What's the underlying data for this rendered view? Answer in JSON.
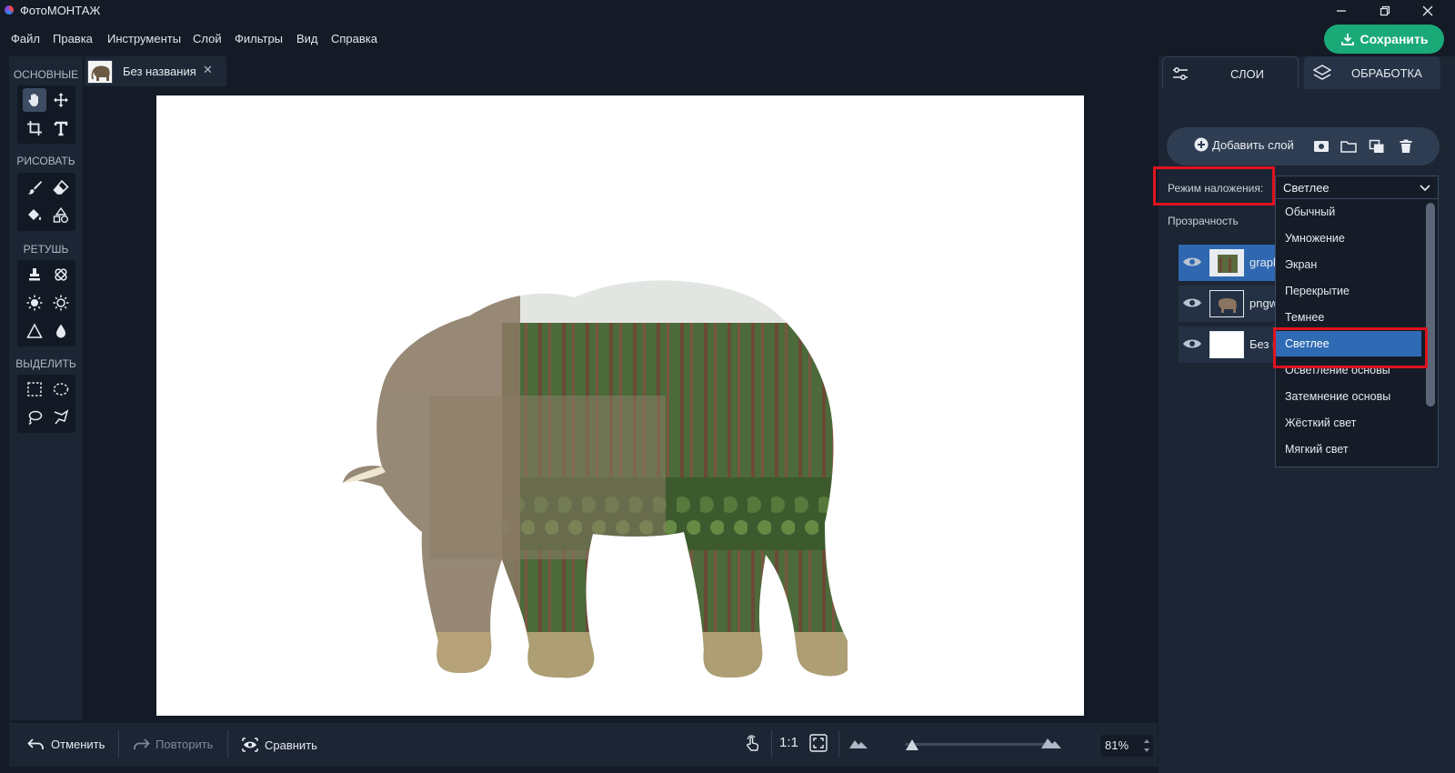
{
  "app": {
    "title": "ФотоМОНТАЖ"
  },
  "menu": [
    "Файл",
    "Правка",
    "Инструменты",
    "Слой",
    "Фильтры",
    "Вид",
    "Справка"
  ],
  "save_label": "Сохранить",
  "tools": {
    "sections": [
      "ОСНОВНЫЕ",
      "РИСОВАТЬ",
      "РЕТУШЬ",
      "ВЫДЕЛИТЬ"
    ]
  },
  "document": {
    "tab_label": "Без названия"
  },
  "right_panel": {
    "tab_layers": "СЛОИ",
    "tab_processing": "ОБРАБОТКА",
    "add_layer": "Добавить слой",
    "blend_label": "Режим наложения:",
    "blend_value": "Светлее",
    "opacity_label": "Прозрачность",
    "layers": [
      {
        "name": "grapl",
        "selected": true
      },
      {
        "name": "pngw",
        "selected": false
      },
      {
        "name": "Без н",
        "selected": false
      }
    ],
    "blend_options": [
      "Обычный",
      "Умножение",
      "Экран",
      "Перекрытие",
      "Темнее",
      "Светлее",
      "Осветление основы",
      "Затемнение основы",
      "Жёсткий свет",
      "Мягкий свет"
    ],
    "blend_selected_index": 5
  },
  "bottom": {
    "undo": "Отменить",
    "redo": "Повторить",
    "compare": "Сравнить",
    "one_to_one": "1:1",
    "zoom": "81%",
    "zoom_slider_fraction": 0.05
  },
  "colors": {
    "accent": "#1aaa78",
    "selection": "#2f6bb4",
    "highlight": "#e0131f"
  }
}
